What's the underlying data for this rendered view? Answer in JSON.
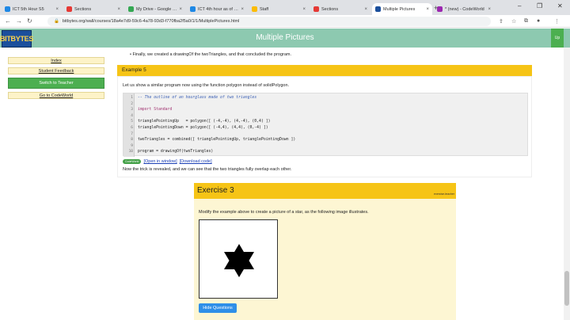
{
  "browser": {
    "tabs": [
      {
        "label": "ICT 5th Hour S5",
        "color": "#1e88e5"
      },
      {
        "label": "Sections",
        "color": "#e53935"
      },
      {
        "label": "My Drive - Google Drive",
        "color": "#34a853"
      },
      {
        "label": "ICT 4th hour as of 11/29",
        "color": "#1e88e5"
      },
      {
        "label": "Staff",
        "color": "#fbbc05"
      },
      {
        "label": "Sections",
        "color": "#e53935"
      },
      {
        "label": "Multiple Pictures",
        "color": "#1b4f9c"
      },
      {
        "label": "* (new) - CodeWorld",
        "color": "#9c27b0"
      }
    ],
    "active_tab_index": 6,
    "url": "bitbytes.org/wall/courses/18a4e7d9-59c6-4a78-93d3-f770fba2f5a0/1/1/MultiplePictures.html",
    "new_tab_glyph": "+",
    "window_controls": [
      "–",
      "❐",
      "✕"
    ]
  },
  "header": {
    "logo_text": "BITBYTES",
    "title": "Multiple Pictures",
    "up_label": "Up"
  },
  "sidebar": {
    "items": [
      {
        "label": "Index"
      },
      {
        "label": "Student Feedback"
      },
      {
        "label": "Switch to Teacher"
      },
      {
        "label": "Go to CodeWorld"
      }
    ]
  },
  "content": {
    "bullet": "Finally, we created a drawingOf the twoTriangles, and that concluded the program.",
    "example5": {
      "title": "Example 5",
      "intro": "Let us show a similar program now using the function polygon instead of solidPolygon.",
      "code_lines": [
        {
          "n": "1",
          "text": "-- The outline of an hourglass made of two triangles",
          "kind": "comment"
        },
        {
          "n": "2",
          "text": "",
          "kind": "plain"
        },
        {
          "n": "3",
          "text": "import Standard",
          "kind": "kw"
        },
        {
          "n": "4",
          "text": "",
          "kind": "plain"
        },
        {
          "n": "5",
          "text": "trianglePointingUp   = polygon([ (-4,-4), (4,-4), (0,4) ])",
          "kind": "plain"
        },
        {
          "n": "6",
          "text": "trianglePointingDown = polygon([ (-4,4), (4,4), (0,-4) ])",
          "kind": "plain"
        },
        {
          "n": "7",
          "text": "",
          "kind": "plain"
        },
        {
          "n": "8",
          "text": "twoTriangles = combined([ trianglePointingUp, trianglePointingDown ])",
          "kind": "plain"
        },
        {
          "n": "9",
          "text": "",
          "kind": "plain"
        },
        {
          "n": "10",
          "text": "program = drawingOf(twoTriangles)",
          "kind": "plain"
        }
      ],
      "badge": "CodeWorld",
      "open_link": "[Open in window]",
      "download_link": "[Download code]",
      "after": "Now the trick is revealed, and we can see that the two triangles fully overlap each other."
    },
    "exercise3": {
      "title": "Exercise 3",
      "tag": "exercise-teacher",
      "text": "Modify the example above to create a picture of a star, as the following image illustrates.",
      "hide_button": "Hide Questions"
    }
  }
}
